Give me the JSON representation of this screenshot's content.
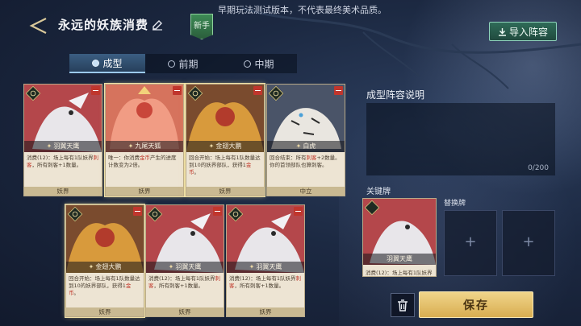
{
  "header": {
    "title": "永远的妖族消费",
    "newbie_badge": "新手",
    "notice": "早期玩法测试版本，不代表最终美术品质。",
    "import_button": "导入阵容"
  },
  "tabs": [
    {
      "label": "成型",
      "active": true
    },
    {
      "label": "前期",
      "active": false
    },
    {
      "label": "中期",
      "active": false
    }
  ],
  "cards_row1": [
    {
      "name": "羽翼天鹰",
      "desc_pre": "消费(12)：场上每有1队妖界",
      "desc_hl": "刺客",
      "desc_post": "，所有刺客+1数量。",
      "faction": "妖界"
    },
    {
      "name": "九尾天狐",
      "desc_pre": "唯一：你消费",
      "desc_hl": "金币",
      "desc_post": "产生的进度计数变为2倍。",
      "faction": "妖界"
    },
    {
      "name": "金翅大鹏",
      "desc_pre": "回合开始：场上每有1队数量达到10的妖界部队，获得1",
      "desc_hl": "金币",
      "desc_post": "。",
      "faction": "妖界"
    },
    {
      "name": "白虎",
      "desc_pre": "回合结束：所有",
      "desc_hl": "刺客",
      "desc_post": "+2数量。你的首领部队也算刺客。",
      "faction": "中立"
    }
  ],
  "cards_row2": [
    {
      "name": "金翅大鹏",
      "desc_pre": "回合开始：场上每有1队数量达到10的妖界部队，获得1",
      "desc_hl": "金币",
      "desc_post": "。",
      "faction": "妖界"
    },
    {
      "name": "羽翼天鹰",
      "desc_pre": "消费(12)：场上每有1队妖界",
      "desc_hl": "刺客",
      "desc_post": "，所有刺客+1数量。",
      "faction": "妖界"
    },
    {
      "name": "羽翼天鹰",
      "desc_pre": "消费(12)：场上每有1队妖界",
      "desc_hl": "刺客",
      "desc_post": "，所有刺客+1数量。",
      "faction": "妖界"
    }
  ],
  "panel": {
    "title": "成型阵容说明",
    "char_count": "0/200",
    "key_label": "关键牌",
    "swap_label": "替换牌",
    "key_card": {
      "name": "羽翼天鹰",
      "desc_pre": "消费(12)：场上每有1队妖界",
      "desc_hl": "刺客"
    },
    "plus": "+",
    "save_button": "保存"
  }
}
